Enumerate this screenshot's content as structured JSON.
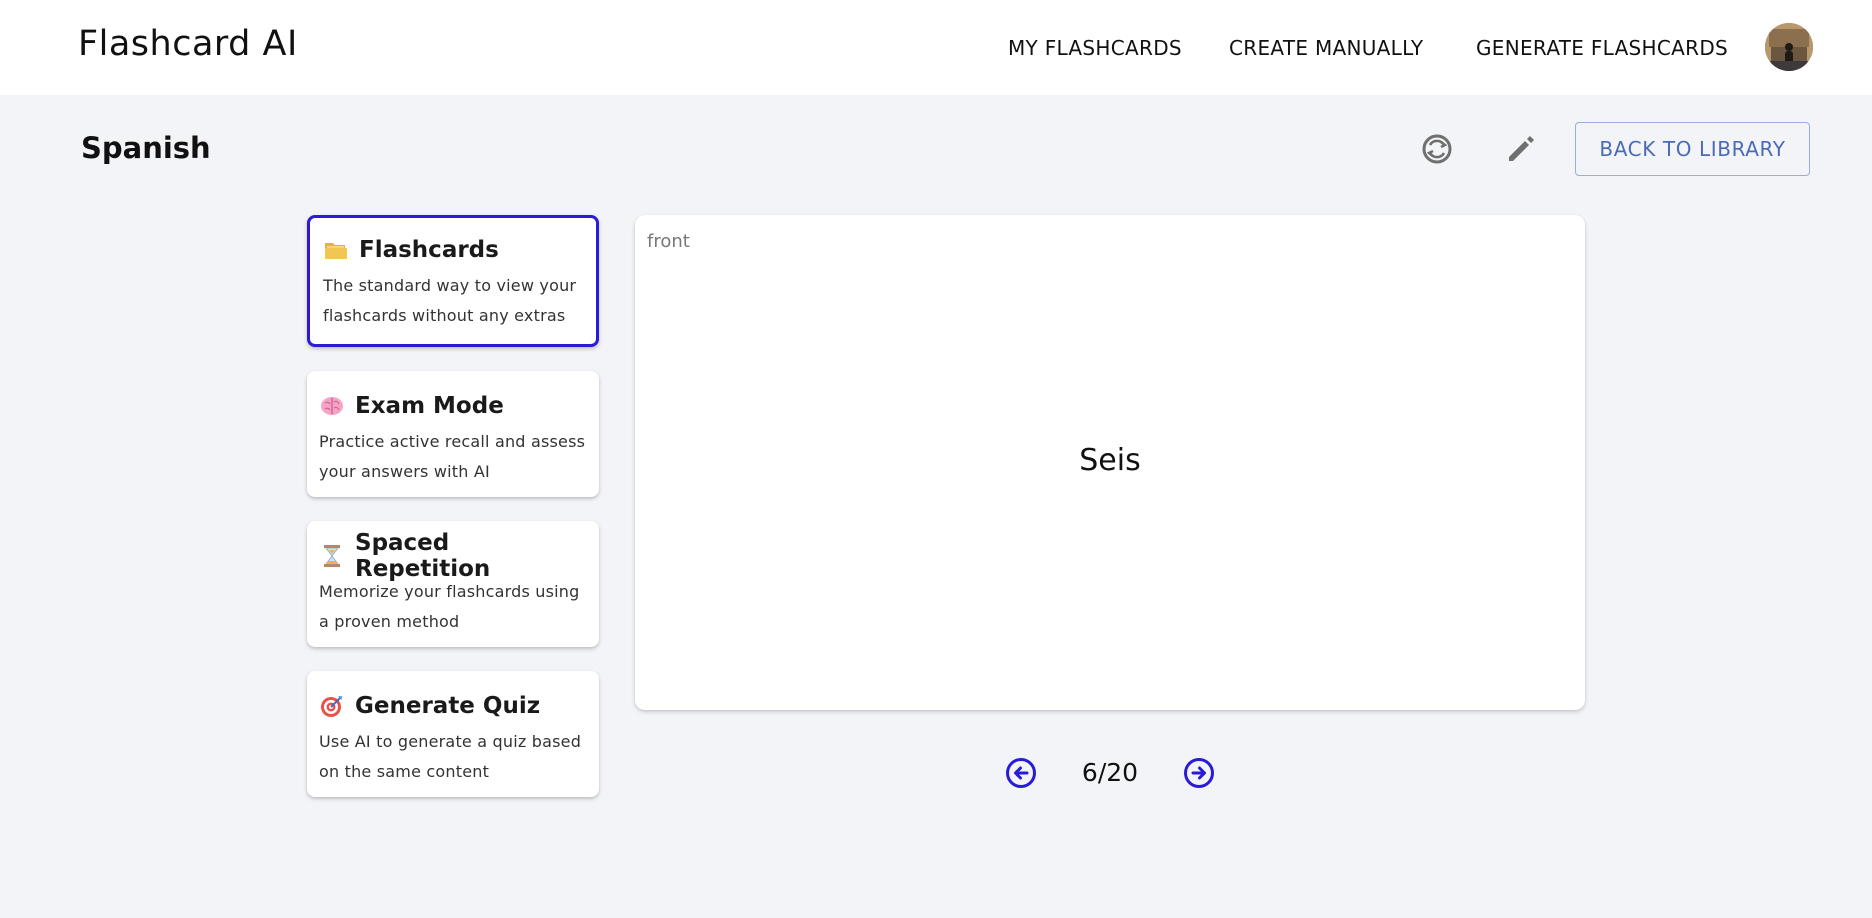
{
  "header": {
    "logo": "Flashcard AI",
    "nav": [
      "MY FLASHCARDS",
      "CREATE MANUALLY",
      "GENERATE FLASHCARDS"
    ],
    "avatar_icon": "user-avatar"
  },
  "deck": {
    "title": "Spanish",
    "back_label": "BACK TO LIBRARY",
    "shuffle_icon": "shuffle-icon",
    "edit_icon": "pencil-icon"
  },
  "modes": [
    {
      "icon": "folder-icon",
      "title": "Flashcards",
      "description": "The standard way to view your flashcards without any extras",
      "active": true
    },
    {
      "icon": "brain-icon",
      "title": "Exam Mode",
      "description": "Practice active recall and assess your answers with AI",
      "active": false
    },
    {
      "icon": "hourglass-icon",
      "title": "Spaced Repetition",
      "description": "Memorize your flashcards using a proven method",
      "active": false
    },
    {
      "icon": "target-icon",
      "title": "Generate Quiz",
      "description": "Use AI to generate a quiz based on the same content",
      "active": false
    }
  ],
  "card": {
    "side": "front",
    "text": "Seis"
  },
  "pager": {
    "counter": "6/20",
    "current": 6,
    "total": 20
  },
  "colors": {
    "accent": "#2a1bd6",
    "background": "#f3f4f8",
    "back_button": "#4a6bb5"
  }
}
